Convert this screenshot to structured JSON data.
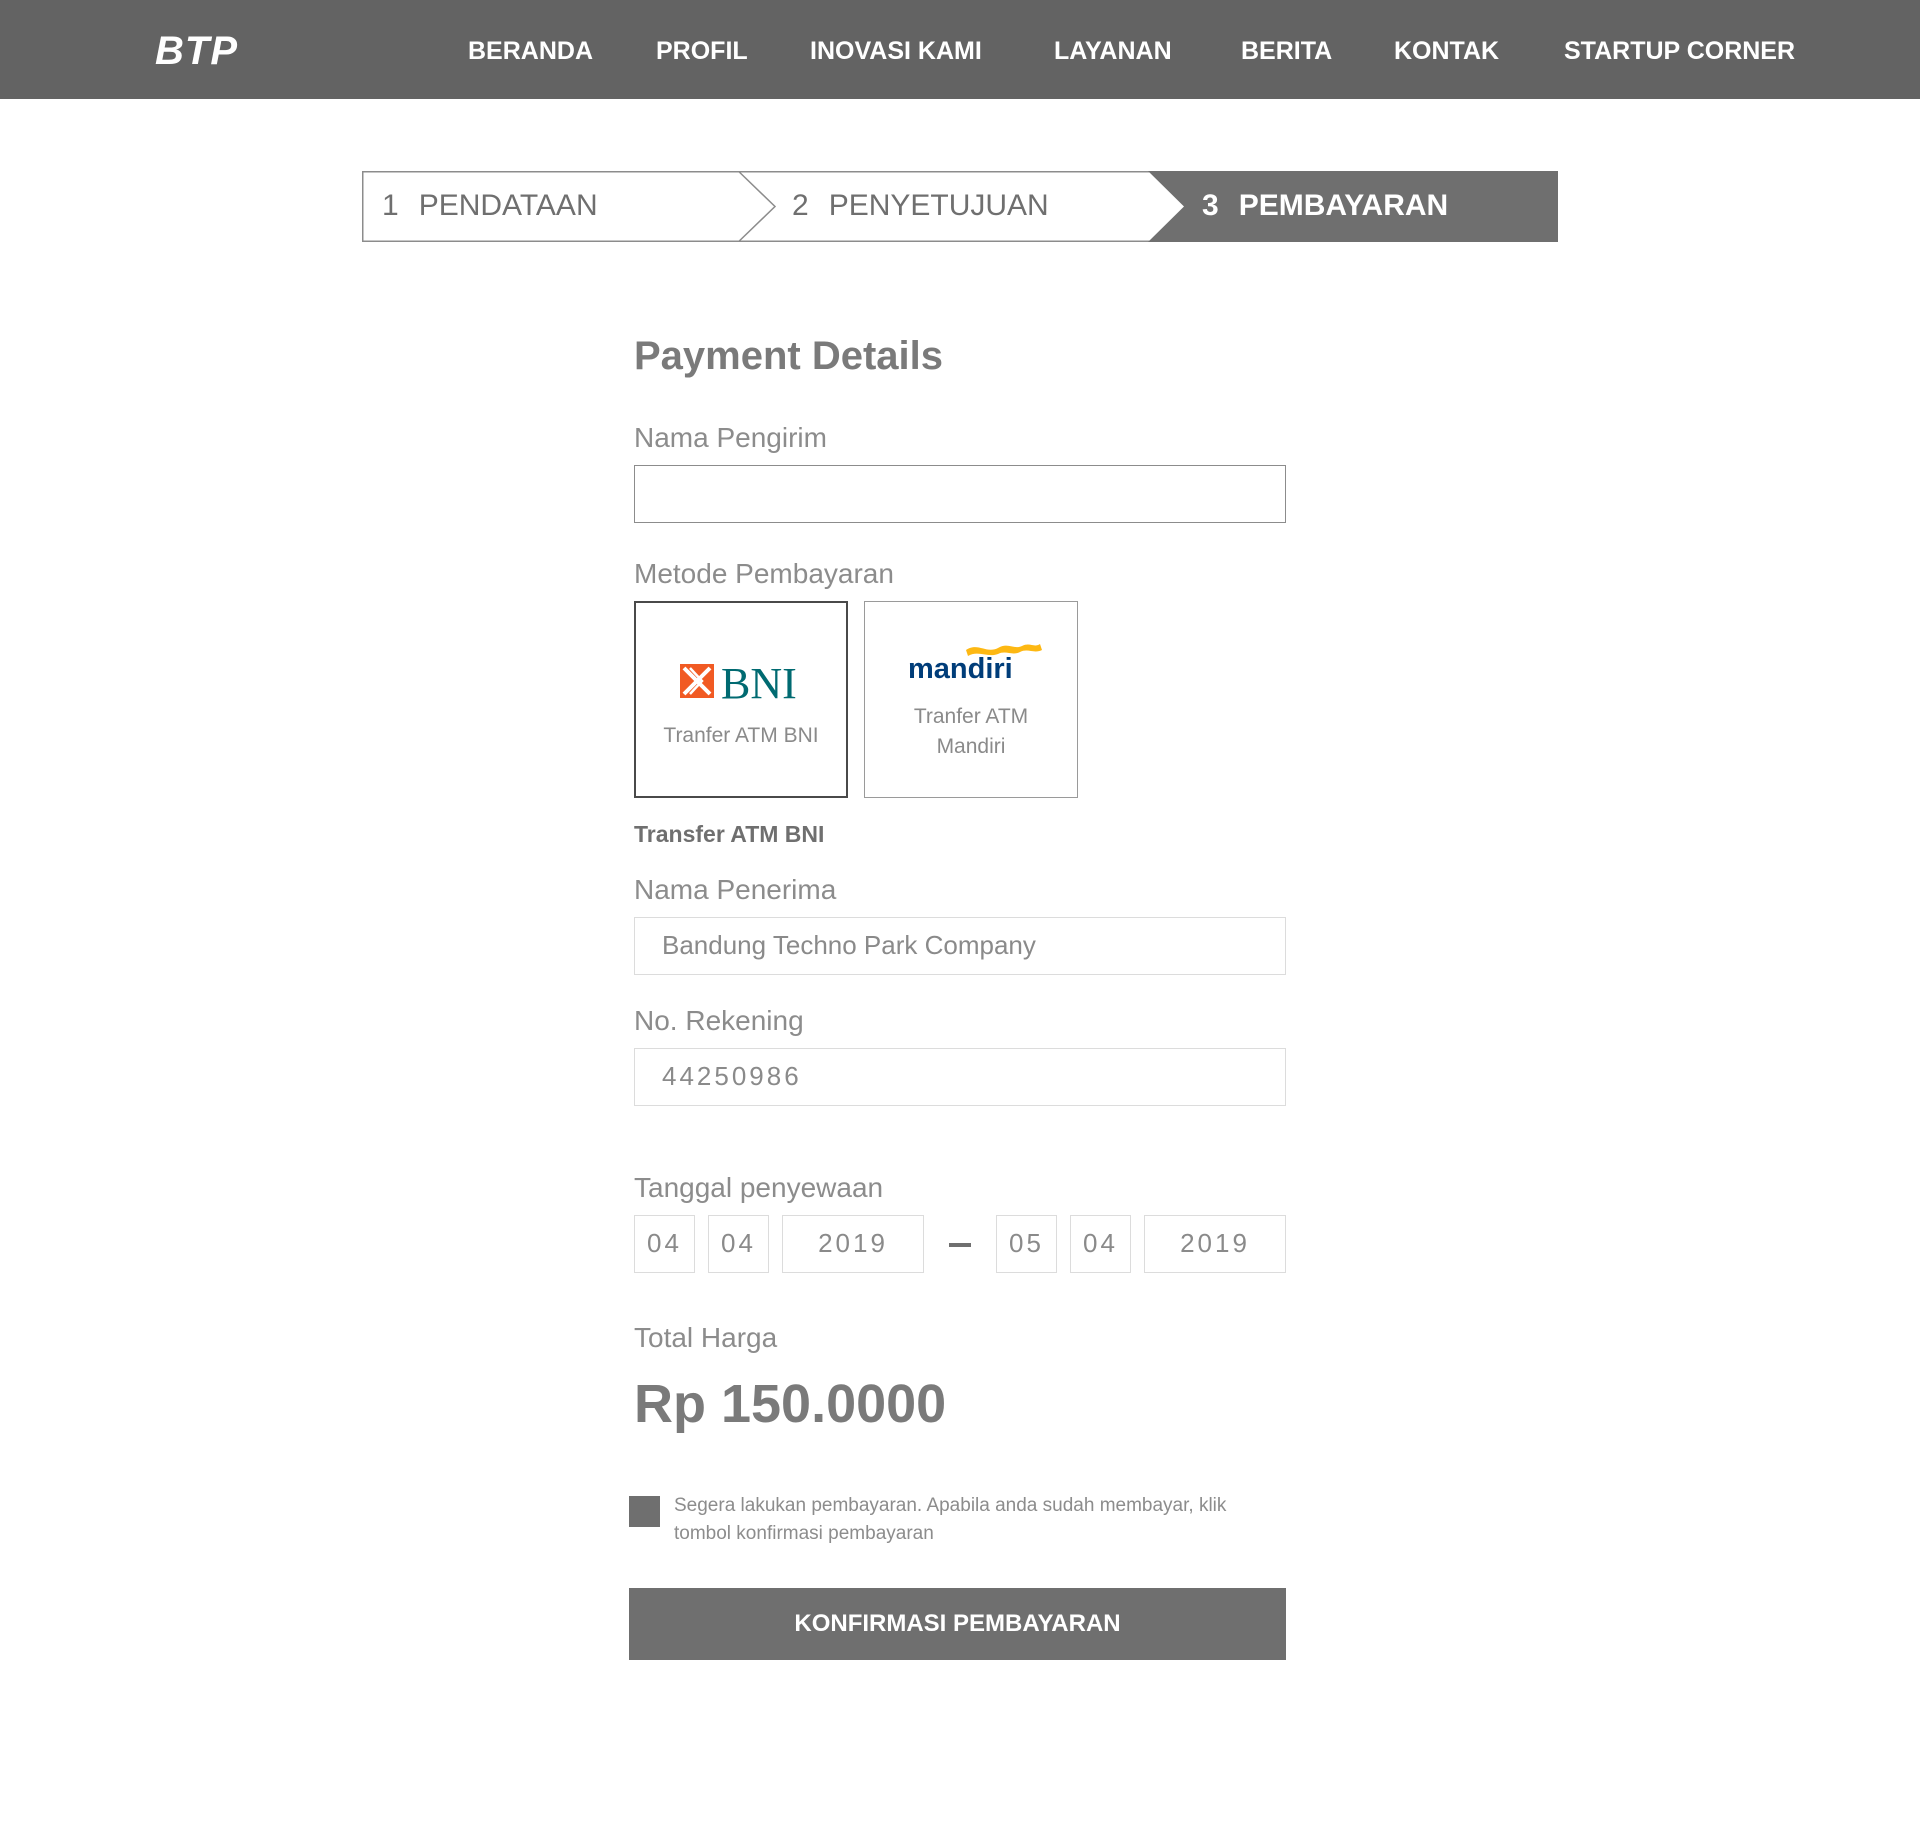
{
  "header": {
    "logo": "BTP",
    "nav": [
      "BERANDA",
      "PROFIL",
      "INOVASI KAMI",
      "LAYANAN",
      "BERITA",
      "KONTAK",
      "STARTUP CORNER"
    ]
  },
  "stepper": {
    "steps": [
      {
        "num": "1",
        "label": "PENDATAAN"
      },
      {
        "num": "2",
        "label": "PENYETUJUAN"
      },
      {
        "num": "3",
        "label": "PEMBAYARAN"
      }
    ],
    "active_step": 3
  },
  "form": {
    "title": "Payment Details",
    "sender_label": "Nama Pengirim",
    "sender_value": "",
    "method_label": "Metode Pembayaran",
    "methods": [
      {
        "logo_text": "BNI",
        "caption": "Tranfer ATM BNI",
        "icon": "bni-logo-icon",
        "selected": true
      },
      {
        "logo_text": "mandiri",
        "caption_line1": "Tranfer ATM",
        "caption_line2": "Mandiri",
        "icon": "mandiri-logo-icon",
        "selected": false
      }
    ],
    "selected_method": "Transfer ATM BNI",
    "recipient_label": "Nama Penerima",
    "recipient_value": "Bandung Techno Park Company",
    "account_label": "No. Rekening",
    "account_value": "44250986",
    "rental_label": "Tanggal penyewaan",
    "rental_from": {
      "day": "04",
      "month": "04",
      "year": "2019"
    },
    "rental_to": {
      "day": "05",
      "month": "04",
      "year": "2019"
    },
    "total_label": "Total Harga",
    "total_value": "Rp 150.0000",
    "notice_text": "Segera lakukan pembayaran. Apabila anda sudah membayar, klik tombol konfirmasi pembayaran",
    "confirm_label": "KONFIRMASI PEMBAYARAN"
  },
  "colors": {
    "header_bg": "#636363",
    "active_step_bg": "#6f6f6f",
    "button_bg": "#6f6f6f",
    "bni_orange": "#f15a23",
    "bni_teal": "#006a71",
    "mandiri_navy": "#003d79",
    "mandiri_yellow": "#fdb813"
  }
}
